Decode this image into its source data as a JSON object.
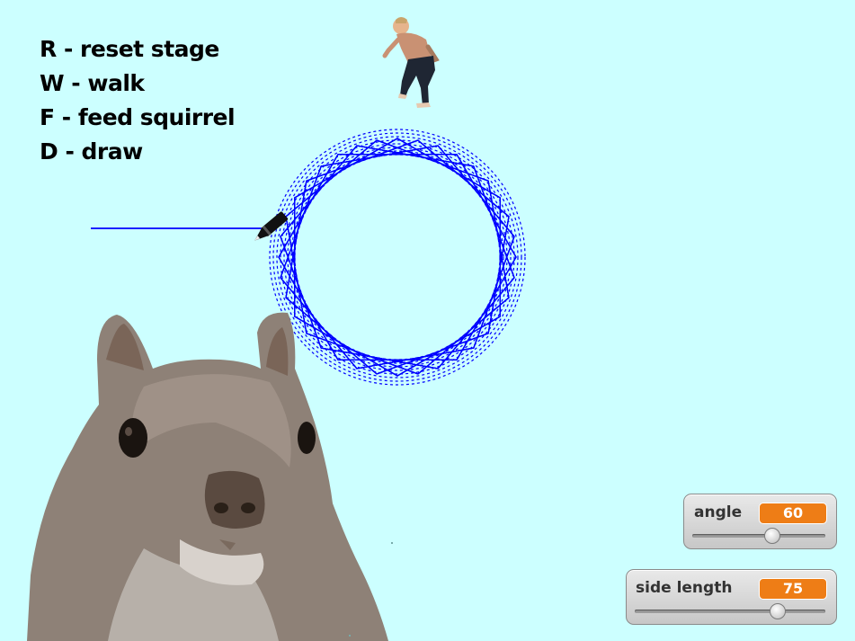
{
  "instructions": [
    "R - reset stage",
    "W - walk",
    "F - feed squirrel",
    "D - draw"
  ],
  "watchers": [
    {
      "label": "angle",
      "value": "60",
      "slider_fraction": 0.6
    },
    {
      "label": "side length",
      "value": "75",
      "slider_fraction": 0.75
    }
  ],
  "colors": {
    "stage_background": "#ccffff",
    "pen": "#0000ff",
    "watcher_value": "#ee7d16"
  },
  "sprites": [
    "walking-man-sprite",
    "pencil-sprite",
    "squirrel-sprite"
  ]
}
